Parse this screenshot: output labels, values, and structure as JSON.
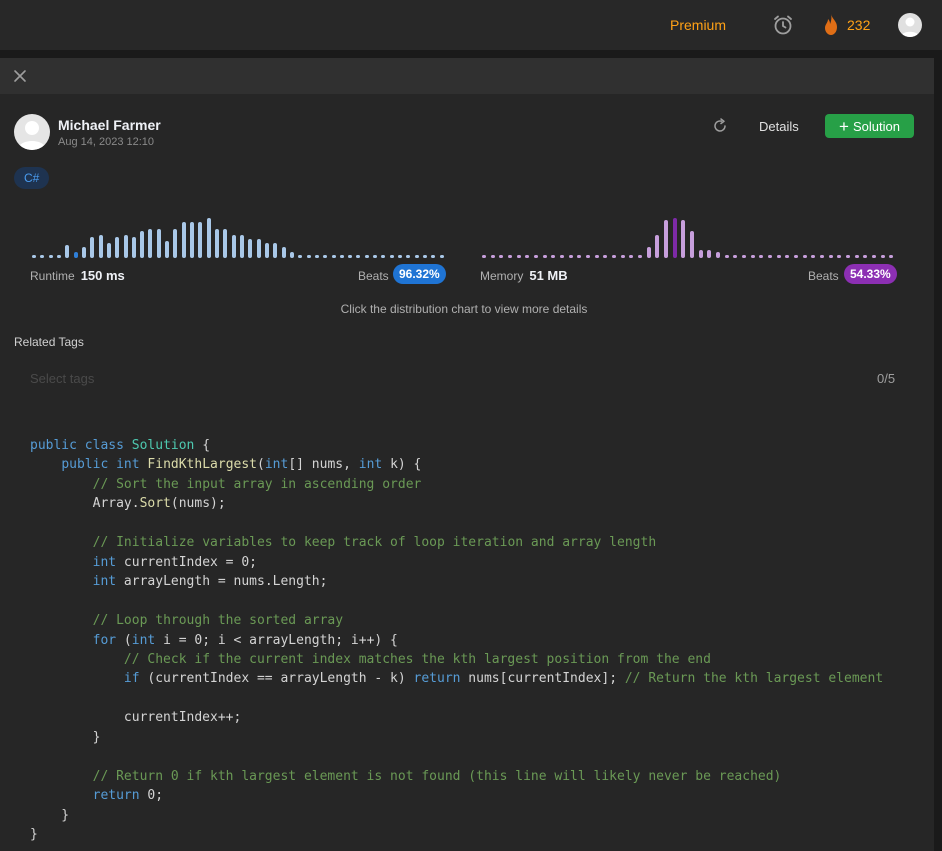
{
  "nav": {
    "premium_label": "Premium",
    "streak_count": "232",
    "icons": [
      "alarm-clock-icon",
      "fire-icon",
      "user-avatar"
    ]
  },
  "submission": {
    "author": "Michael Farmer",
    "date": "Aug 14, 2023 12:10",
    "details_label": "Details",
    "solution_label": "Solution",
    "language": "C#"
  },
  "runtime": {
    "label": "Runtime",
    "value": "150 ms",
    "beats_label": "Beats",
    "beats_pct": "96.32%",
    "color": "#1f74d4"
  },
  "memory": {
    "label": "Memory",
    "value": "51 MB",
    "beats_label": "Beats",
    "beats_pct": "54.33%",
    "color": "#8c2fb3"
  },
  "hint": "Click the distribution chart to view more details",
  "tags": {
    "title": "Related Tags",
    "placeholder": "Select tags",
    "count": "0/5"
  },
  "code_lines": [
    "public class Solution {",
    "    public int FindKthLargest(int[] nums, int k) {",
    "        // Sort the input array in ascending order",
    "        Array.Sort(nums);",
    "",
    "        // Initialize variables to keep track of loop iteration and array length",
    "        int currentIndex = 0;",
    "        int arrayLength = nums.Length;",
    "",
    "        // Loop through the sorted array",
    "        for (int i = 0; i < arrayLength; i++) {",
    "            // Check if the current index matches the kth largest position from the end",
    "            if (currentIndex == arrayLength - k) return nums[currentIndex]; // Return the kth largest element",
    "",
    "            currentIndex++;",
    "        }",
    "",
    "        // Return 0 if kth largest element is not found (this line will likely never be reached)",
    "        return 0;",
    "    }",
    "}"
  ],
  "chart_data": [
    {
      "type": "bar",
      "name": "runtime-distribution",
      "values": [
        1,
        1,
        1,
        1,
        6,
        3,
        5,
        10,
        11,
        7,
        10,
        11,
        10,
        13,
        14,
        14,
        8,
        14,
        17,
        17,
        17,
        19,
        14,
        14,
        11,
        11,
        9,
        9,
        7,
        7,
        5,
        3,
        1,
        1,
        1,
        1,
        1,
        1,
        1,
        1,
        1,
        1,
        1,
        1,
        1,
        1,
        1,
        1,
        1,
        1
      ],
      "highlight_index": 5
    },
    {
      "type": "bar",
      "name": "memory-distribution",
      "values": [
        1,
        1,
        1,
        1,
        1,
        1,
        1,
        1,
        1,
        1,
        1,
        1,
        1,
        1,
        1,
        1,
        1,
        1,
        1,
        5,
        11,
        18,
        19,
        18,
        13,
        4,
        4,
        3,
        1,
        1,
        1,
        1,
        1,
        1,
        1,
        1,
        1,
        1,
        1,
        1,
        1,
        1,
        1,
        1,
        1,
        1,
        1,
        1
      ],
      "highlight_index": 22
    }
  ]
}
